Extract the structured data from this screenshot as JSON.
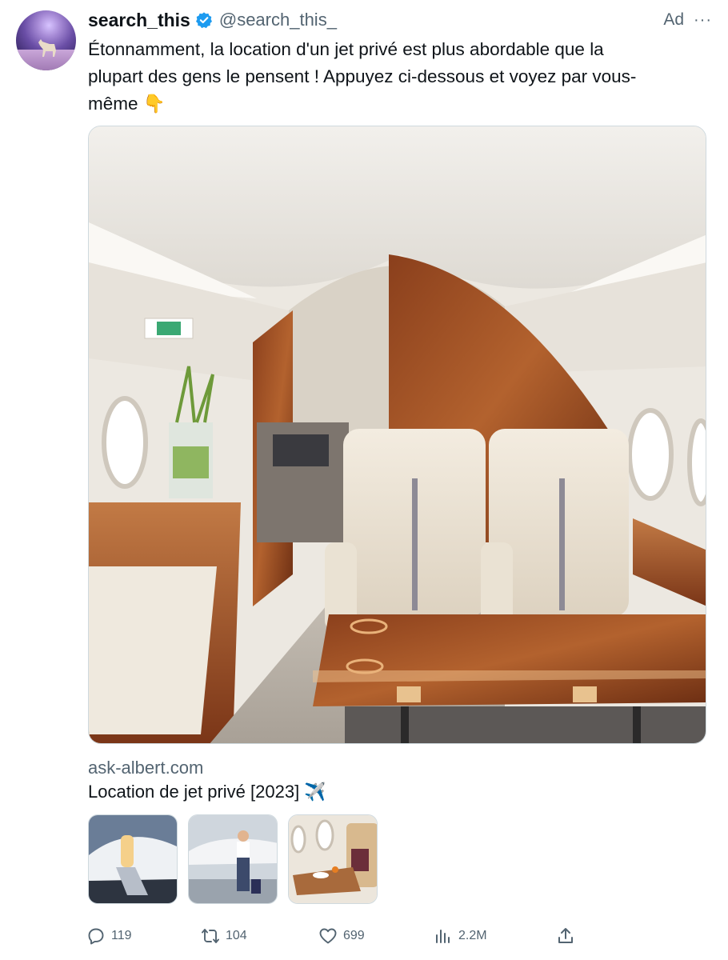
{
  "author": {
    "name": "search_this",
    "handle": "@search_this_",
    "verified_icon": "verified-badge-icon"
  },
  "ad_label": "Ad",
  "more_label": "···",
  "tweet": {
    "text_line1": "Étonnamment, la location d'un jet privé est plus abordable que la",
    "text_line2": "plupart des gens le pensent ! Appuyez ci-dessous et voyez par vous-",
    "text_line3": "même 👇"
  },
  "card": {
    "domain": "ask-albert.com",
    "title": "Location de jet privé [2023] ✈️"
  },
  "actions": {
    "replies": "119",
    "retweets": "104",
    "likes": "699",
    "views": "2.2M"
  },
  "colors": {
    "text": "#0f1419",
    "secondary": "#536471",
    "verified": "#1d9bf0"
  }
}
